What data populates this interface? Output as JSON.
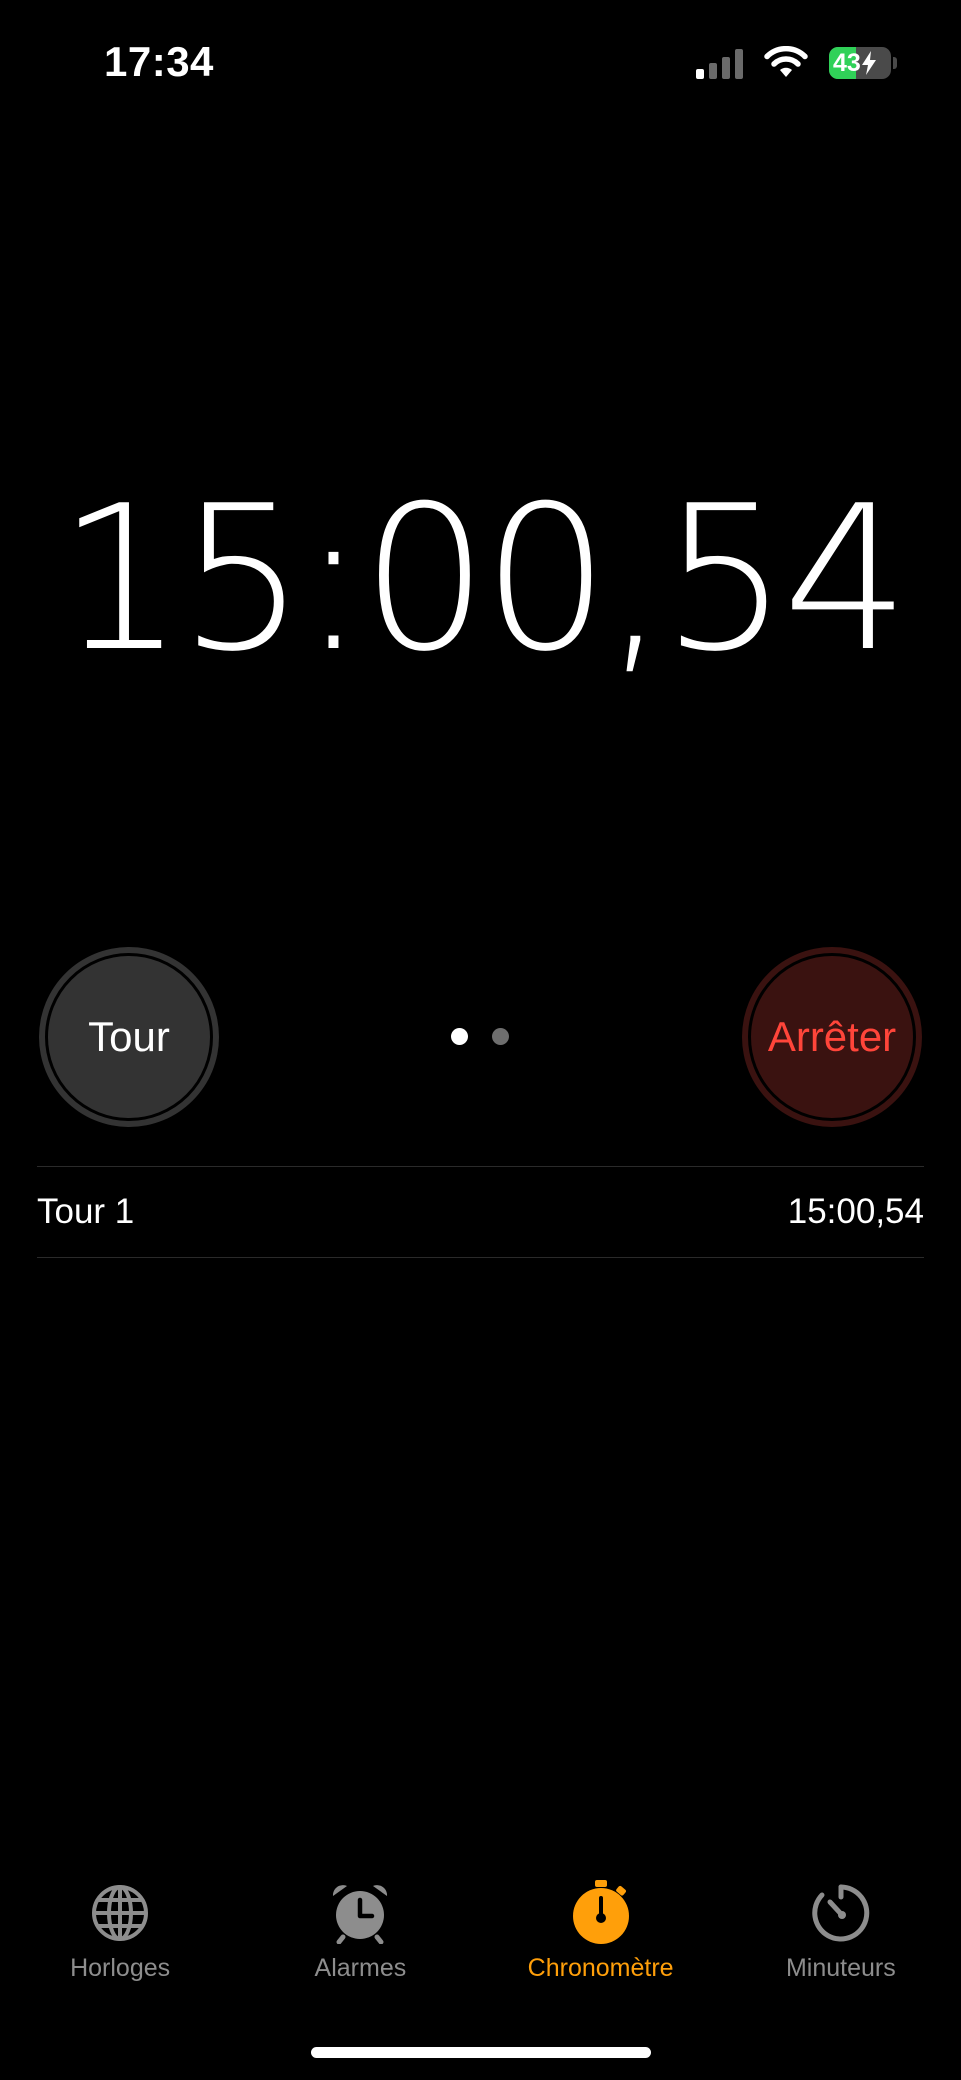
{
  "status_bar": {
    "time": "17:34",
    "battery_level": "43",
    "battery_fraction": 0.43,
    "signal_bars": 1,
    "icons": [
      "cellular-signal-icon",
      "wifi-icon",
      "battery-charging-icon"
    ]
  },
  "stopwatch": {
    "elapsed": "15:00,54"
  },
  "controls": {
    "lap_label": "Tour",
    "stop_label": "Arrêter",
    "page_count": 2,
    "active_page": 0
  },
  "laps": [
    {
      "label": "Tour 1",
      "time": "15:00,54"
    }
  ],
  "tab_bar": {
    "active_index": 2,
    "tabs": [
      {
        "label": "Horloges",
        "icon": "globe-icon"
      },
      {
        "label": "Alarmes",
        "icon": "alarm-clock-icon"
      },
      {
        "label": "Chronomètre",
        "icon": "stopwatch-icon"
      },
      {
        "label": "Minuteurs",
        "icon": "timer-icon"
      }
    ]
  },
  "colors": {
    "background": "#000000",
    "accent": "#ff9f0a",
    "stop_red": "#ff453a",
    "stop_bg": "#3a1210",
    "lap_bg": "#333333",
    "inactive_tab": "#8d8d8d",
    "battery_green": "#30d158"
  }
}
